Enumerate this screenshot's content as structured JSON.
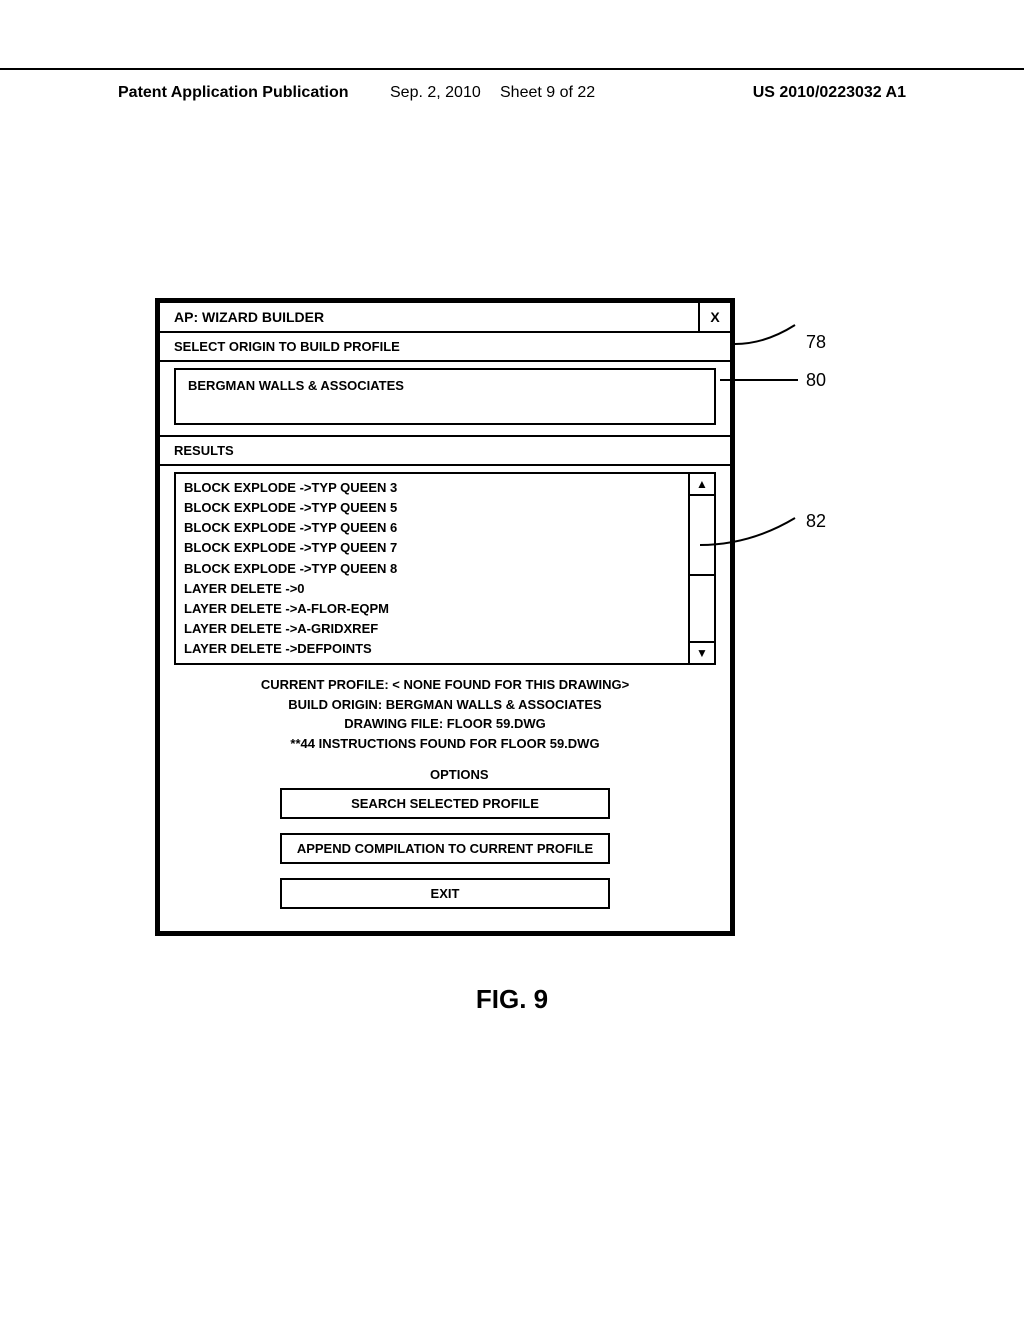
{
  "header": {
    "publication_label": "Patent Application Publication",
    "date": "Sep. 2, 2010",
    "sheet": "Sheet 9 of 22",
    "pub_number": "US 2010/0223032 A1"
  },
  "dialog": {
    "title": "AP: WIZARD BUILDER",
    "close": "X",
    "select_label": "SELECT ORIGIN TO BUILD PROFILE",
    "origin_value": "BERGMAN WALLS & ASSOCIATES",
    "results_label": "RESULTS",
    "results": [
      "BLOCK EXPLODE ->TYP QUEEN 3",
      "BLOCK EXPLODE ->TYP QUEEN 5",
      "BLOCK EXPLODE ->TYP QUEEN 6",
      "BLOCK EXPLODE ->TYP QUEEN 7",
      "BLOCK EXPLODE ->TYP QUEEN 8",
      "LAYER DELETE ->0",
      "LAYER DELETE ->A-FLOR-EQPM",
      "LAYER DELETE ->A-GRIDXREF",
      "LAYER DELETE ->DEFPOINTS"
    ],
    "info": {
      "line1": "CURRENT PROFILE: < NONE FOUND FOR THIS DRAWING>",
      "line2": "BUILD ORIGIN: BERGMAN WALLS & ASSOCIATES",
      "line3": "DRAWING FILE: FLOOR 59.DWG",
      "line4": "**44 INSTRUCTIONS FOUND FOR FLOOR 59.DWG"
    },
    "options_label": "OPTIONS",
    "buttons": {
      "search": "SEARCH SELECTED PROFILE",
      "append": "APPEND COMPILATION TO CURRENT PROFILE",
      "exit": "EXIT"
    }
  },
  "callouts": {
    "c78": "78",
    "c80": "80",
    "c82": "82"
  },
  "figure_caption": "FIG. 9",
  "icons": {
    "up": "▲",
    "down": "▼"
  }
}
